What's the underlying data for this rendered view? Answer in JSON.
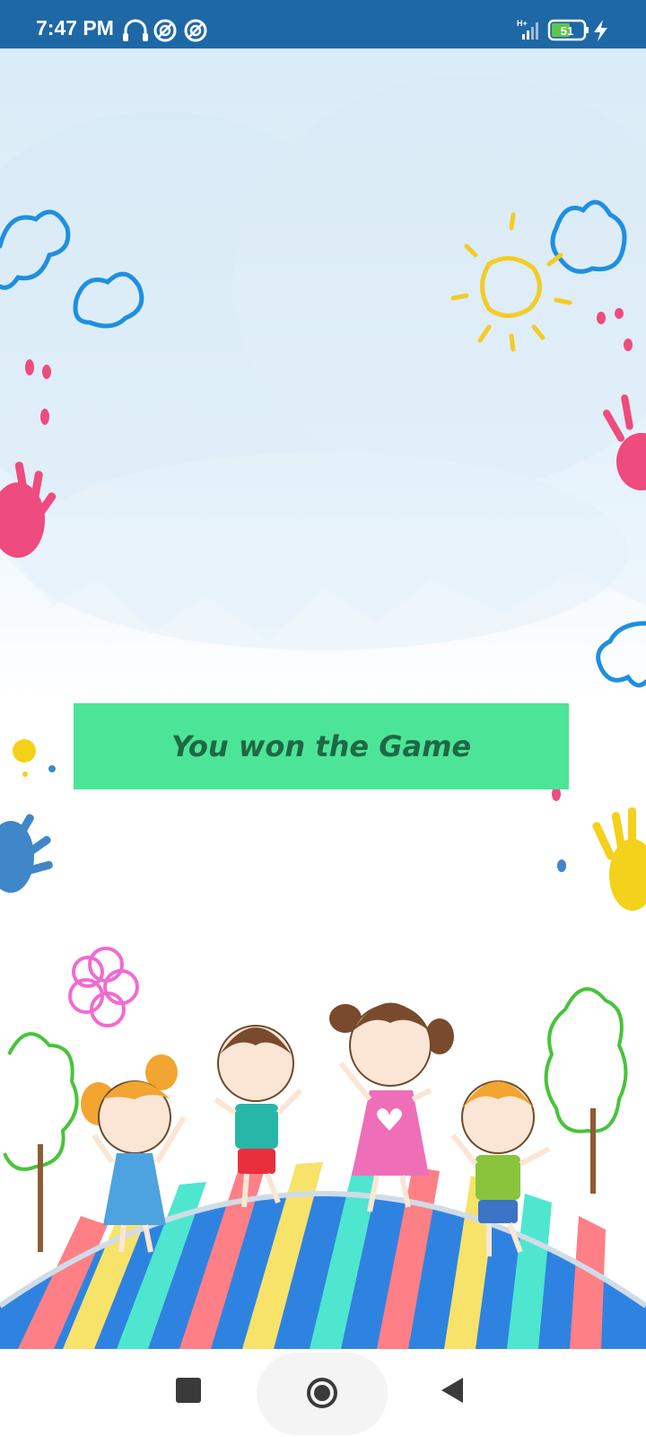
{
  "status_bar": {
    "time": "7:47 PM",
    "network_label": "H+",
    "battery_level": "51",
    "icons": [
      "headphones-icon",
      "sync-icon",
      "sync-icon",
      "signal-icon",
      "battery-icon",
      "charging-icon"
    ]
  },
  "game": {
    "result_text": "You won the Game"
  },
  "nav_bar": {
    "buttons": [
      "recent-apps-icon",
      "home-icon",
      "back-icon"
    ]
  },
  "colors": {
    "status_bar": "#1f68a6",
    "banner": "#4ce597",
    "banner_text": "#1f6844"
  }
}
